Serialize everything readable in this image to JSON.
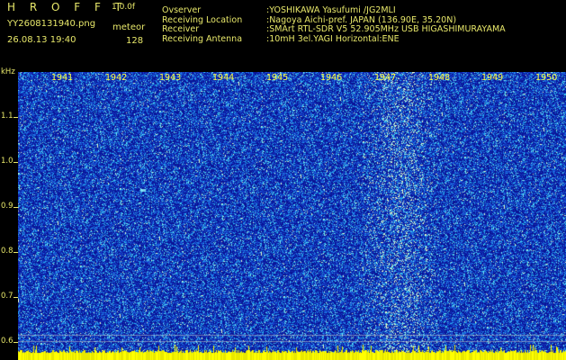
{
  "header": {
    "logo": "H R O F F T",
    "version": "1.0.0f",
    "filename": "YY2608131940.png",
    "datetime": "26.08.13 19:40",
    "meteor_label": "meteor",
    "meteor_count": "128"
  },
  "info": [
    {
      "key": "Ovserver",
      "value": ":YOSHIKAWA Yasufumi /JG2MLI"
    },
    {
      "key": "Receiving Location",
      "value": ":Nagoya Aichi-pref. JAPAN (136.90E, 35.20N)"
    },
    {
      "key": "Receiver",
      "value": ":SMArt RTL-SDR V5 52.905MHz USB HIGASHIMURAYAMA"
    },
    {
      "key": "Receiving Antenna",
      "value": ":10mH 3el.YAGI Horizontal:ENE"
    }
  ],
  "yaxis": {
    "unit": "kHz",
    "ticks": [
      "1.1",
      "1.0",
      "0.9",
      "0.8",
      "0.7",
      "0.6"
    ]
  },
  "xaxis": {
    "ticks": [
      "1941",
      "1942",
      "1943",
      "1944",
      "1945",
      "1946",
      "1947",
      "1948",
      "1949",
      "1950"
    ]
  },
  "colors": {
    "text": "#e8e86a",
    "background": "#000000",
    "waterfall_base": "#1a2fb0"
  }
}
